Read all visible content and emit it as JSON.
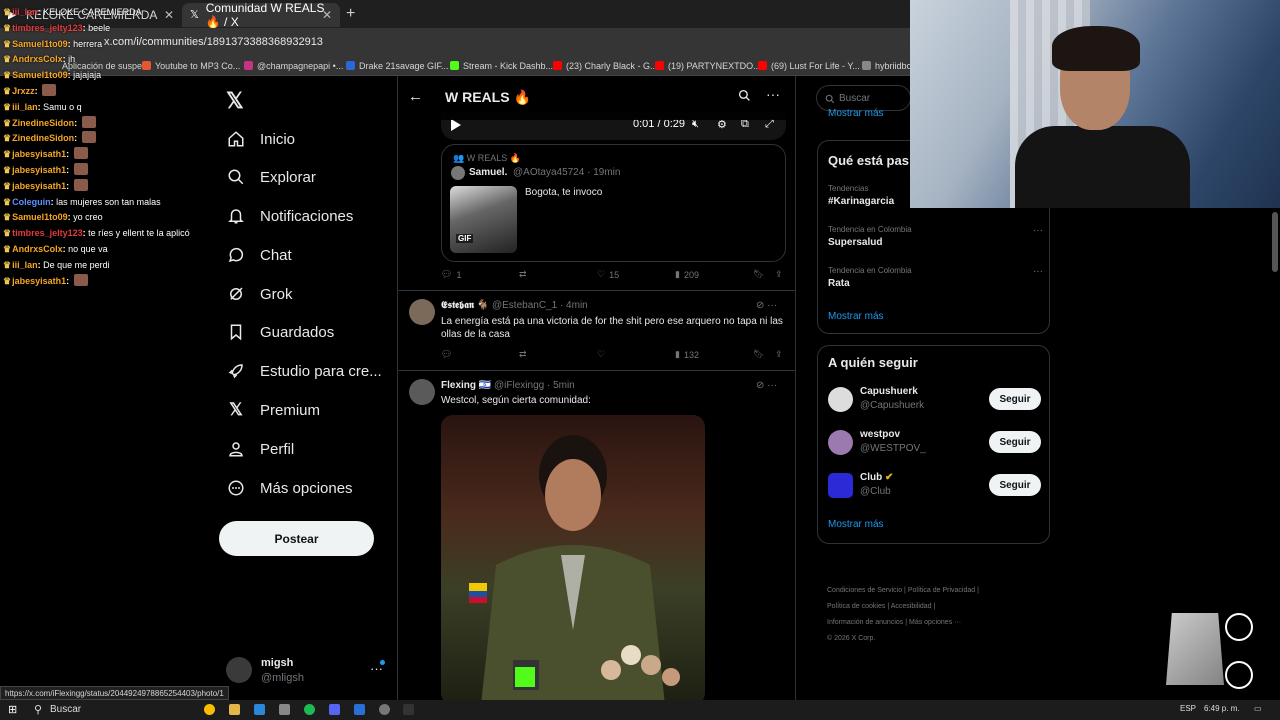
{
  "browser": {
    "tabs": [
      {
        "label": "KELOKE CAREMIERDA",
        "active": false
      },
      {
        "label": "Comunidad W REALS 🔥 / X",
        "active": true
      }
    ],
    "url": "x.com/i/communities/1891373388368932913",
    "bookmarks": [
      "Aplicación de suspe...",
      "Youtube to MP3 Co...",
      "@champagnepapi •...",
      "Drake 21savage GIF...",
      "Stream - Kick Dashb...",
      "(23) Charly Black - G...",
      "(19) PARTYNEXTDO...",
      "(69) Lust For Life - Y...",
      "hybriidbo"
    ],
    "status_url": "https://x.com/iFlexingg/status/2044924978865254403/photo/1"
  },
  "chat": [
    {
      "user": "iii_lan",
      "msg": "KELOKE CAREMIERDA",
      "color": "r"
    },
    {
      "user": "timbres_jelty123",
      "msg": "beele",
      "color": "r"
    },
    {
      "user": "Samuel1to09",
      "msg": "herrera",
      "color": "o"
    },
    {
      "user": "AndrxsColx",
      "msg": "jh",
      "color": "o"
    },
    {
      "user": "Samuel1to09",
      "msg": "jajajaja",
      "color": "o"
    },
    {
      "user": "Jrxzz",
      "msg": "",
      "color": "o"
    },
    {
      "user": "iii_lan",
      "msg": "Samu o q",
      "color": "o"
    },
    {
      "user": "ZinedineSidon",
      "msg": "",
      "color": "o"
    },
    {
      "user": "ZinedineSidon",
      "msg": "",
      "color": "o"
    },
    {
      "user": "jabesyisath1",
      "msg": "",
      "color": "o"
    },
    {
      "user": "jabesyisath1",
      "msg": "",
      "color": "o"
    },
    {
      "user": "jabesyisath1",
      "msg": "",
      "color": "o"
    },
    {
      "user": "Coleguin",
      "msg": "las mujeres son tan malas",
      "color": "b"
    },
    {
      "user": "Samuel1to09",
      "msg": "yo creo",
      "color": "o"
    },
    {
      "user": "timbres_jelty123",
      "msg": "te ríes y ellent te la aplicó",
      "color": "r"
    },
    {
      "user": "AndrxsColx",
      "msg": "no que va",
      "color": "o"
    },
    {
      "user": "iii_lan",
      "msg": "De que me perdi",
      "color": "o"
    },
    {
      "user": "jabesyisath1",
      "msg": "",
      "color": "o"
    }
  ],
  "nav": {
    "items": [
      {
        "label": "Inicio",
        "icon": "home-icon"
      },
      {
        "label": "Explorar",
        "icon": "search-icon"
      },
      {
        "label": "Notificaciones",
        "icon": "bell-icon"
      },
      {
        "label": "Chat",
        "icon": "chat-icon"
      },
      {
        "label": "Grok",
        "icon": "grok-icon"
      },
      {
        "label": "Guardados",
        "icon": "bookmark-icon"
      },
      {
        "label": "Estudio para cre...",
        "icon": "rocket-icon"
      },
      {
        "label": "Premium",
        "icon": "x-premium-icon"
      },
      {
        "label": "Perfil",
        "icon": "person-icon"
      },
      {
        "label": "Más opciones",
        "icon": "more-circle-icon"
      }
    ],
    "post_label": "Postear",
    "account": {
      "name": "migsh",
      "handle": "@mligsh"
    }
  },
  "timeline": {
    "title": "W REALS 🔥",
    "video": {
      "time": "0:01 / 0:29"
    },
    "quote": {
      "community": "W REALS 🔥",
      "name": "Samuel.",
      "meta": "@AOtaya45724 · 19min",
      "text": "Bogota, te invoco",
      "gif_label": "GIF"
    },
    "post1_stats": {
      "replies": "1",
      "likes": "15",
      "views": "209"
    },
    "post2": {
      "name": "𝕰𝖘𝖙𝖊𝖇𝖆𝖓 🐐",
      "meta": "@EstebanC_1 · 4min",
      "text": "La energía está pa una victoria de for the shit pero ese arquero no tapa ni las ollas de la casa",
      "views": "132"
    },
    "post3": {
      "name": "Flexing 🇮🇱",
      "meta": "@iFlexingg · 5min",
      "text": "Westcol, según cierta comunidad:"
    }
  },
  "sidebar": {
    "search_placeholder": "Buscar",
    "trends_title": "Qué está pas",
    "partial_top": "Mostrar más",
    "trends": [
      {
        "context": "Tendencias",
        "topic": "#Karinagarcia"
      },
      {
        "context": "Tendencia en Colombia",
        "topic": "Supersalud"
      },
      {
        "context": "Tendencia en Colombia",
        "topic": "Rata"
      }
    ],
    "show_more": "Mostrar más",
    "follow_title": "A quién seguir",
    "follow": [
      {
        "name": "Capushuerk",
        "handle": "@Capushuerk",
        "button": "Seguir"
      },
      {
        "name": "westpov",
        "handle": "@WESTPOV_",
        "button": "Seguir"
      },
      {
        "name": "Club",
        "handle": "@Club",
        "button": "Seguir"
      }
    ],
    "footer": {
      "terms": "Condiciones de Servicio",
      "privacy": "Política de Privacidad",
      "cookies": "Política de cookies",
      "access": "Accesibilidad",
      "ads": "Información de anuncios",
      "more": "Más opciones ···",
      "copy": "© 2026 X Corp."
    }
  },
  "taskbar": {
    "search": "Buscar",
    "lang": "ESP",
    "time": "6:49 p. m."
  },
  "colors": {
    "accent": "#1d9bf0",
    "bg": "#000000",
    "border": "#2f3336"
  }
}
